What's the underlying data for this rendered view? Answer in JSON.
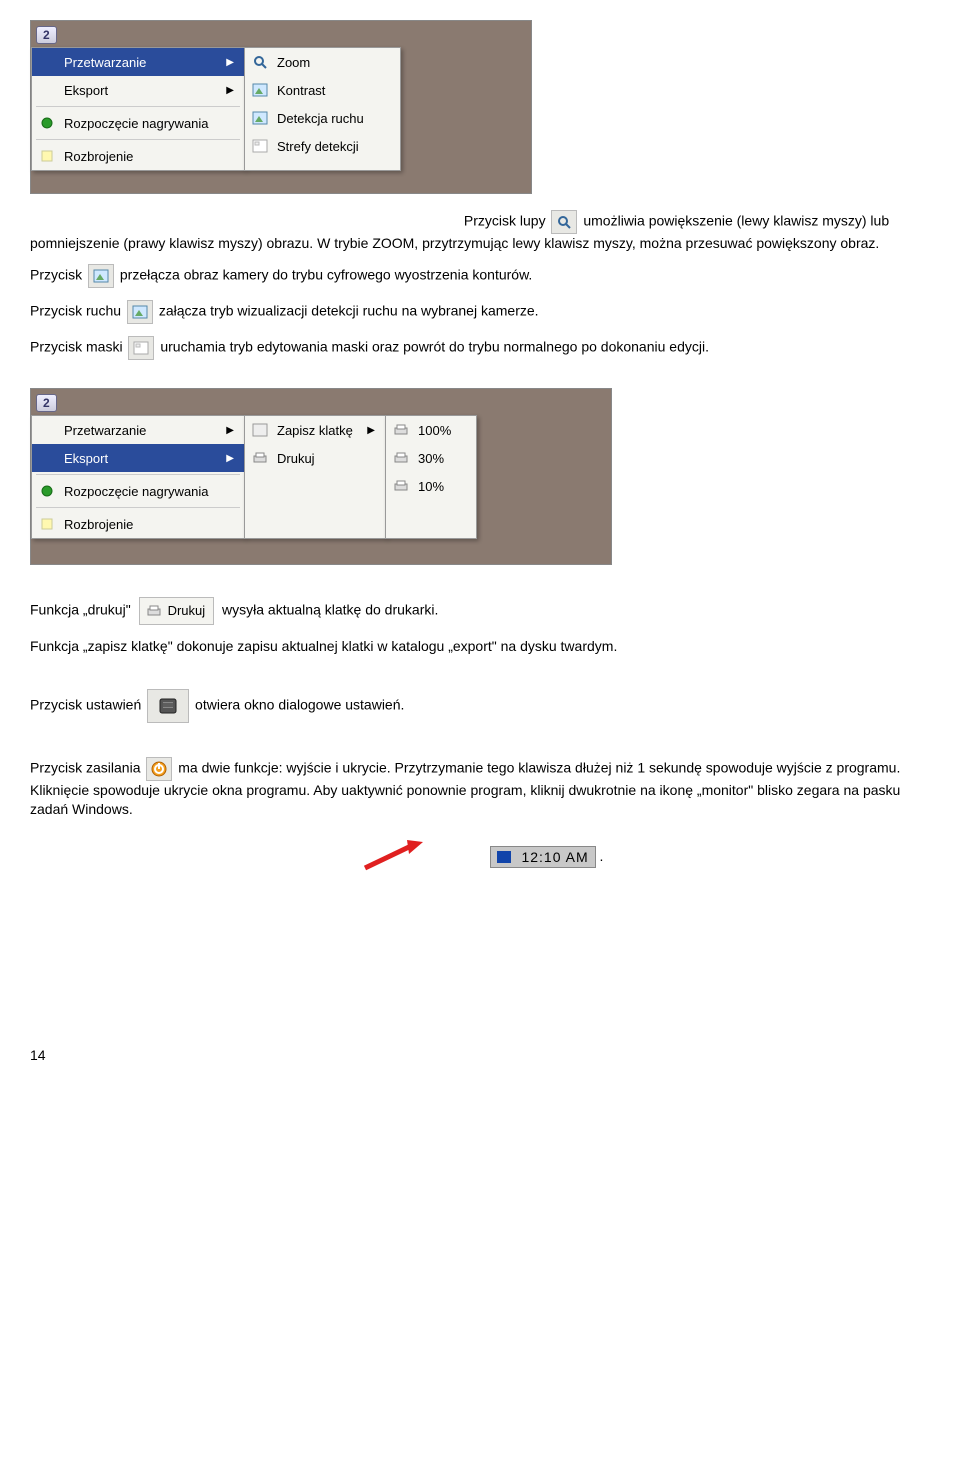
{
  "screenshot1": {
    "badge": "2",
    "menuA": {
      "items": [
        {
          "label": "Przetwarzanie",
          "arrow": true,
          "hover": true
        },
        {
          "label": "Eksport",
          "arrow": true
        },
        {
          "label": "Rozpoczęcie nagrywania"
        },
        {
          "label": "Rozbrojenie"
        }
      ]
    },
    "menuB": {
      "items": [
        {
          "label": "Zoom"
        },
        {
          "label": "Kontrast"
        },
        {
          "label": "Detekcja ruchu"
        },
        {
          "label": "Strefy detekcji"
        }
      ]
    }
  },
  "para1_a": "Przycisk lupy ",
  "para1_b": " umożliwia powiększenie (lewy klawisz myszy) lub pomniejszenie (prawy klawisz myszy) obrazu. W trybie ZOOM, przytrzymując lewy klawisz myszy, można przesuwać powiększony obraz.",
  "para2_a": "Przycisk ",
  "para2_b": " przełącza obraz kamery do trybu cyfrowego wyostrzenia konturów.",
  "para3_a": "Przycisk ruchu ",
  "para3_b": " załącza tryb wizualizacji detekcji ruchu na wybranej kamerze.",
  "para4_a": "Przycisk maski ",
  "para4_b": " uruchamia tryb edytowania maski oraz powrót do trybu normalnego po dokonaniu edycji.",
  "screenshot2": {
    "badge": "2",
    "menuA": {
      "items": [
        {
          "label": "Przetwarzanie",
          "arrow": true
        },
        {
          "label": "Eksport",
          "arrow": true,
          "hover": true
        },
        {
          "label": "Rozpoczęcie nagrywania"
        },
        {
          "label": "Rozbrojenie"
        }
      ]
    },
    "menuB": {
      "items": [
        {
          "label": "Zapisz klatkę",
          "arrow": true
        },
        {
          "label": "Drukuj"
        }
      ]
    },
    "menuC": {
      "items": [
        {
          "label": "100%"
        },
        {
          "label": "30%"
        },
        {
          "label": "10%"
        }
      ]
    }
  },
  "drukuj_btn": "Drukuj",
  "para5_a": "Funkcja „drukuj\" ",
  "para5_b": " wysyła aktualną klatkę do drukarki.",
  "para6": "Funkcja „zapisz klatkę\" dokonuje zapisu aktualnej klatki w katalogu „export\" na dysku twardym.",
  "para7_a": "Przycisk ustawień ",
  "para7_b": " otwiera okno dialogowe ustawień.",
  "para8_a": "Przycisk zasilania ",
  "para8_b": "ma dwie funkcje: wyjście i ukrycie. Przytrzymanie tego klawisza dłużej niż 1 sekundę spowoduje wyjście z programu. Kliknięcie spowoduje ukrycie okna programu. Aby uaktywnić ponownie program, kliknij dwukrotnie na ikonę „monitor\" blisko zegara na pasku zadań Windows.",
  "tray_time": "12:10 AM",
  "page_number": "14"
}
